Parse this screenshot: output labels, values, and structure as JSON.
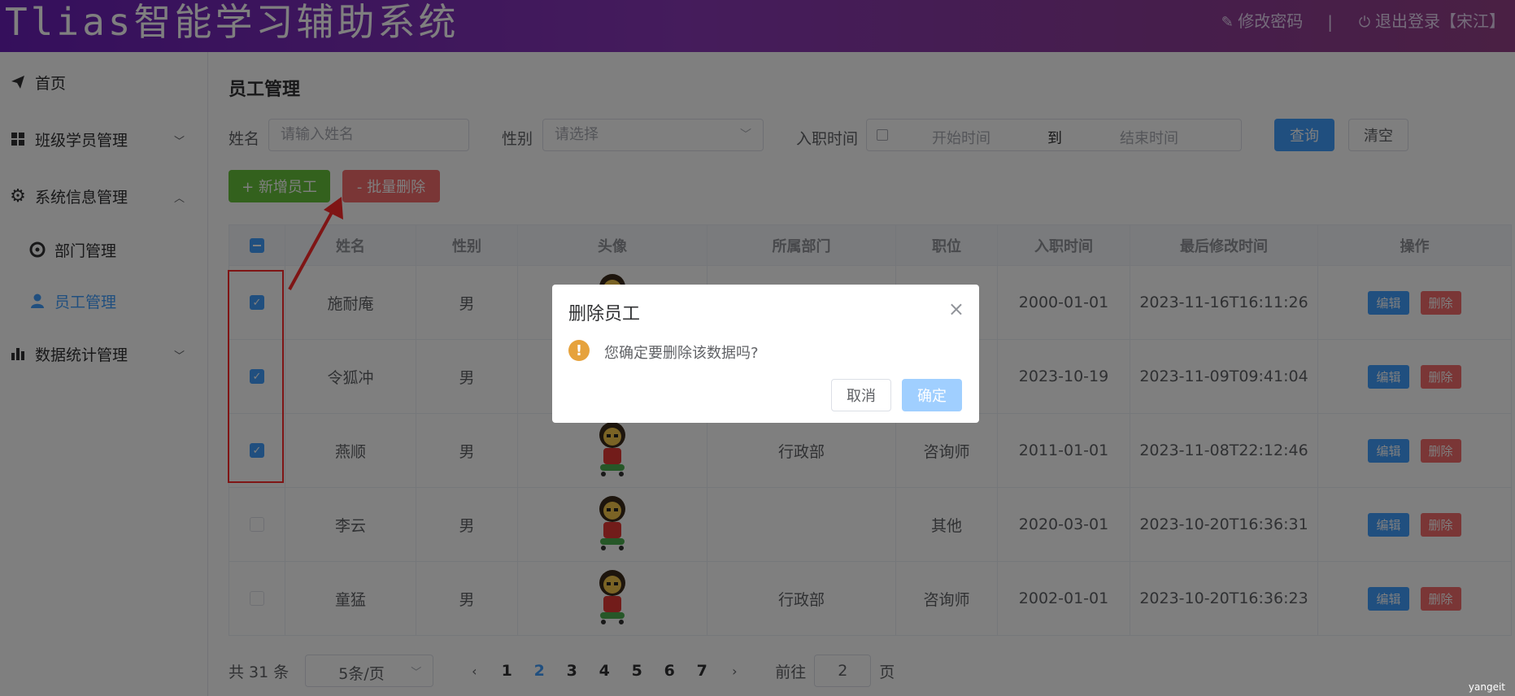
{
  "header": {
    "app_title": "Tlias智能学习辅助系统",
    "change_password": "修改密码",
    "separator": "|",
    "logout": "退出登录【宋江】"
  },
  "sidebar": {
    "items": [
      {
        "label": "首页",
        "icon": "paper-plane-icon"
      },
      {
        "label": "班级学员管理",
        "icon": "grid-icon",
        "expanded": false
      },
      {
        "label": "系统信息管理",
        "icon": "gear-icon",
        "expanded": true
      },
      {
        "label": "部门管理",
        "icon": "compass-icon"
      },
      {
        "label": "员工管理",
        "icon": "user-icon",
        "active": true
      },
      {
        "label": "数据统计管理",
        "icon": "bar-chart-icon",
        "expanded": false
      }
    ]
  },
  "main": {
    "page_title": "员工管理",
    "search": {
      "name_label": "姓名",
      "name_placeholder": "请输入姓名",
      "gender_label": "性别",
      "gender_placeholder": "请选择",
      "date_label": "入职时间",
      "date_start": "开始时间",
      "date_to": "到",
      "date_end": "结束时间",
      "query_button": "查询",
      "clear_button": "清空"
    },
    "actions": {
      "add": "+ 新增员工",
      "batch_delete": "- 批量删除"
    },
    "table": {
      "headers": [
        "姓名",
        "性别",
        "头像",
        "所属部门",
        "职位",
        "入职时间",
        "最后修改时间",
        "操作"
      ],
      "edit_label": "编辑",
      "delete_label": "删除",
      "rows": [
        {
          "checked": true,
          "name": "施耐庵",
          "gender": "男",
          "dept": "",
          "job": "",
          "entry": "2000-01-01",
          "updated": "2023-11-16T16:11:26"
        },
        {
          "checked": true,
          "name": "令狐冲",
          "gender": "男",
          "dept": "",
          "job": "",
          "entry": "2023-10-19",
          "updated": "2023-11-09T09:41:04"
        },
        {
          "checked": true,
          "name": "燕顺",
          "gender": "男",
          "dept": "行政部",
          "job": "咨询师",
          "entry": "2011-01-01",
          "updated": "2023-11-08T22:12:46"
        },
        {
          "checked": false,
          "name": "李云",
          "gender": "男",
          "dept": "",
          "job": "其他",
          "entry": "2020-03-01",
          "updated": "2023-10-20T16:36:31"
        },
        {
          "checked": false,
          "name": "童猛",
          "gender": "男",
          "dept": "行政部",
          "job": "咨询师",
          "entry": "2002-01-01",
          "updated": "2023-10-20T16:36:23"
        }
      ]
    },
    "pagination": {
      "total": "共 31 条",
      "page_size": "5条/页",
      "pages": [
        "1",
        "2",
        "3",
        "4",
        "5",
        "6",
        "7"
      ],
      "current_page": "2",
      "prev": "‹",
      "next": "›",
      "goto_label": "前往",
      "goto_value": "2",
      "goto_suffix": "页"
    }
  },
  "dialog": {
    "title": "删除员工",
    "message": "您确定要删除该数据吗?",
    "cancel": "取消",
    "confirm": "确定",
    "close": "×",
    "warn_symbol": "!"
  },
  "watermark": "yangeit",
  "colors": {
    "primary": "#409eff",
    "success": "#67c23a",
    "danger": "#f56c6c",
    "warning": "#e6a23c",
    "header_start": "#6a1fb8",
    "header_end": "#944088",
    "annotation_red": "#ff2a2a"
  }
}
